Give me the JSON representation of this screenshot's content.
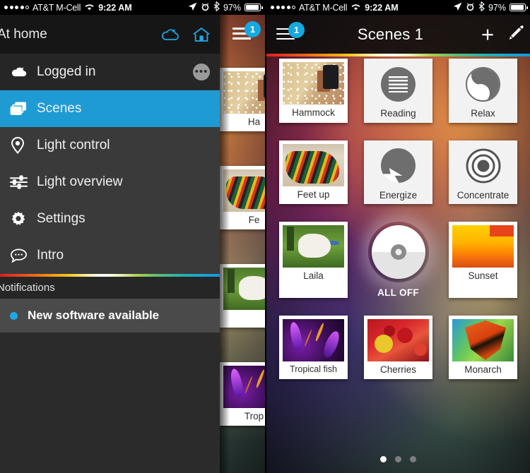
{
  "status_bar": {
    "signal_dots_filled": 4,
    "signal_dots_total": 5,
    "carrier": "AT&T M-Cell",
    "wifi_icon": "wifi-icon",
    "time": "9:22 AM",
    "location_icon": "location-arrow-icon",
    "alarm_icon": "alarm-clock-icon",
    "bluetooth_icon": "bluetooth-icon",
    "battery_percent": "97%",
    "battery_level": 97
  },
  "colors": {
    "accent_blue": "#1f9bd4",
    "badge_blue": "#16a8e0",
    "drawer_bg": "#2b2b2b",
    "drawer_item_bg": "#3a3a3a",
    "notification_bg": "#4a4a4a",
    "tile_white": "#ffffff",
    "icon_grey": "#6e6e6e"
  },
  "left_phone": {
    "drawer": {
      "header": {
        "title": "At home",
        "cloud_icon": "cloud-icon",
        "home_icon": "home-icon"
      },
      "account_row": {
        "icon": "cloud-icon",
        "label": "Logged in",
        "more_label": "•••"
      },
      "items": [
        {
          "icon": "scenes-icon",
          "label": "Scenes",
          "active": true
        },
        {
          "icon": "light-control-icon",
          "label": "Light control",
          "active": false
        },
        {
          "icon": "light-overview-icon",
          "label": "Light overview",
          "active": false
        },
        {
          "icon": "settings-gear-icon",
          "label": "Settings",
          "active": false
        },
        {
          "icon": "intro-chat-icon",
          "label": "Intro",
          "active": false
        }
      ],
      "notifications": {
        "header": "Notifications",
        "items": [
          {
            "label": "New software available",
            "unread": true
          }
        ]
      }
    },
    "menu_button": {
      "icon": "hamburger-menu-icon",
      "badge": "1"
    },
    "background_tiles": [
      "Ha",
      "Fe",
      "",
      "Trop"
    ]
  },
  "right_phone": {
    "navbar": {
      "menu_icon": "hamburger-menu-icon",
      "menu_badge": "1",
      "title": "Scenes 1",
      "add_label": "+",
      "edit_icon": "pencil-edit-icon"
    },
    "scenes": [
      [
        {
          "label": "Hammock",
          "kind": "photo",
          "art": "th-hammock"
        },
        {
          "label": "Reading",
          "kind": "icon",
          "icon": "reading-lines-icon"
        },
        {
          "label": "Relax",
          "kind": "icon",
          "icon": "relax-yinyang-icon"
        }
      ],
      [
        {
          "label": "Feet up",
          "kind": "photo",
          "art": "th-feet"
        },
        {
          "label": "Energize",
          "kind": "icon",
          "icon": "energize-bolt-icon"
        },
        {
          "label": "Concentrate",
          "kind": "icon",
          "icon": "concentrate-target-icon"
        }
      ],
      [
        {
          "label": "Laila",
          "kind": "photo",
          "art": "th-laila"
        },
        {
          "label": "ALL OFF",
          "kind": "alloff",
          "icon": "all-off-dial-icon"
        },
        {
          "label": "Sunset",
          "kind": "photo",
          "art": "th-sunset"
        }
      ],
      [
        {
          "label": "Tropical fish",
          "kind": "photo",
          "art": "th-tropical"
        },
        {
          "label": "Cherries",
          "kind": "photo",
          "art": "th-cherries"
        },
        {
          "label": "Monarch",
          "kind": "photo",
          "art": "th-monarch"
        }
      ]
    ],
    "pagination": {
      "total": 3,
      "active_index": 0
    }
  }
}
